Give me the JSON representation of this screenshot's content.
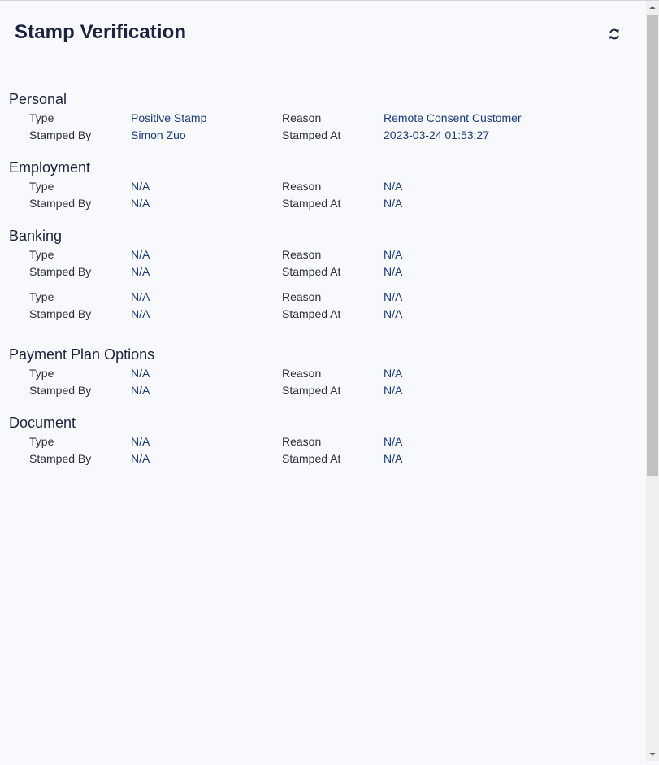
{
  "header": {
    "title": "Stamp Verification",
    "refresh_icon": "refresh-icon"
  },
  "labels": {
    "type": "Type",
    "reason": "Reason",
    "stamped_by": "Stamped By",
    "stamped_at": "Stamped At"
  },
  "sections": {
    "personal": {
      "title": "Personal",
      "type": "Positive Stamp",
      "reason": "Remote Consent Customer",
      "stamped_by": "Simon Zuo",
      "stamped_at": "2023-03-24 01:53:27"
    },
    "employment": {
      "title": "Employment",
      "type": "N/A",
      "reason": "N/A",
      "stamped_by": "N/A",
      "stamped_at": "N/A"
    },
    "banking": {
      "title": "Banking",
      "entries": [
        {
          "type": "N/A",
          "reason": "N/A",
          "stamped_by": "N/A",
          "stamped_at": "N/A"
        },
        {
          "type": "N/A",
          "reason": "N/A",
          "stamped_by": "N/A",
          "stamped_at": "N/A"
        }
      ]
    },
    "payment_plan": {
      "title": "Payment Plan Options",
      "type": "N/A",
      "reason": "N/A",
      "stamped_by": "N/A",
      "stamped_at": "N/A"
    },
    "document": {
      "title": "Document",
      "type": "N/A",
      "reason": "N/A",
      "stamped_by": "N/A",
      "stamped_at": "N/A"
    }
  }
}
